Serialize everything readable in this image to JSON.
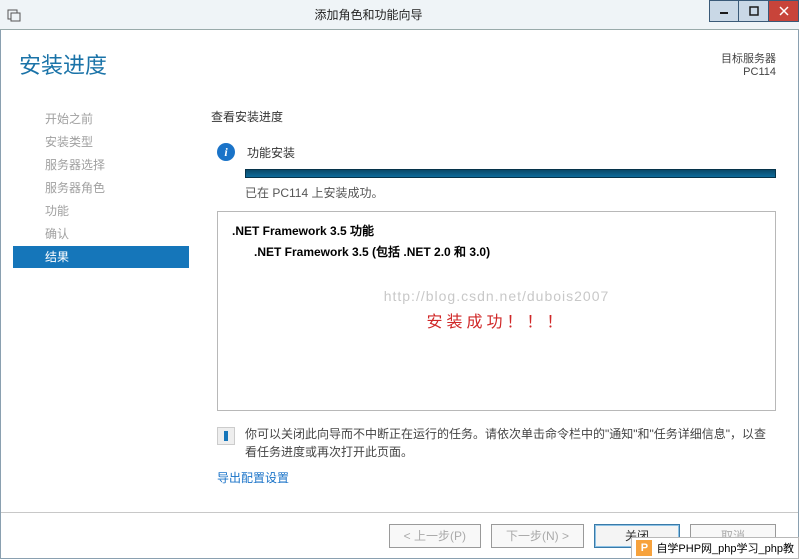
{
  "window": {
    "title": "添加角色和功能向导"
  },
  "header": {
    "heading": "安装进度",
    "dest_label": "目标服务器",
    "dest_value": "PC114"
  },
  "nav": {
    "items": [
      {
        "label": "开始之前"
      },
      {
        "label": "安装类型"
      },
      {
        "label": "服务器选择"
      },
      {
        "label": "服务器角色"
      },
      {
        "label": "功能"
      },
      {
        "label": "确认"
      },
      {
        "label": "结果",
        "active": true
      }
    ]
  },
  "main": {
    "sub_heading": "查看安装进度",
    "info_label": "功能安装",
    "status_line": "已在 PC114 上安装成功。",
    "feature_title": ".NET Framework 3.5 功能",
    "feature_sub": ".NET Framework 3.5 (包括 .NET 2.0 和 3.0)",
    "watermark": "http://blog.csdn.net/dubois2007",
    "success_msg": "安装成功！！！",
    "note_text": "你可以关闭此向导而不中断正在运行的任务。请依次单击命令栏中的\"通知\"和\"任务详细信息\"，以查看任务进度或再次打开此页面。",
    "export_link": "导出配置设置"
  },
  "footer": {
    "prev": "< 上一步(P)",
    "next": "下一步(N) >",
    "close": "关闭",
    "cancel": "取消"
  },
  "tooltip": {
    "text": "自学PHP网_php学习_php教"
  }
}
